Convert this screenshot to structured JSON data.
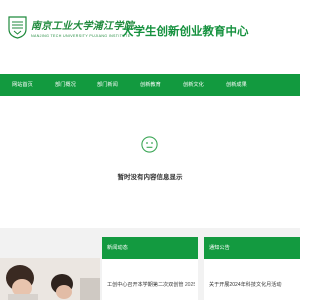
{
  "header": {
    "logo_cn": "南京工业大学浦江学院",
    "logo_en": "NANJING TECH UNIVERSITY PUJIANG INSTITUTE",
    "site_title": "大学生创新创业教育中心"
  },
  "nav": {
    "items": [
      {
        "label": "网站首页"
      },
      {
        "label": "部门概况"
      },
      {
        "label": "部门新闻"
      },
      {
        "label": "创新教育"
      },
      {
        "label": "创新文化"
      },
      {
        "label": "创新成果"
      }
    ]
  },
  "empty_state": {
    "text": "暂时没有内容信息显示"
  },
  "news_panel": {
    "title": "新闻动态",
    "item_text": "工创中心召开本学期第二次双创管",
    "item_date": "2025"
  },
  "notice_panel": {
    "title": "通知公告",
    "item_text": "关于开展2024年科技文化月活动"
  },
  "colors": {
    "brand_green": "#129a3f",
    "title_green": "#15913e"
  }
}
